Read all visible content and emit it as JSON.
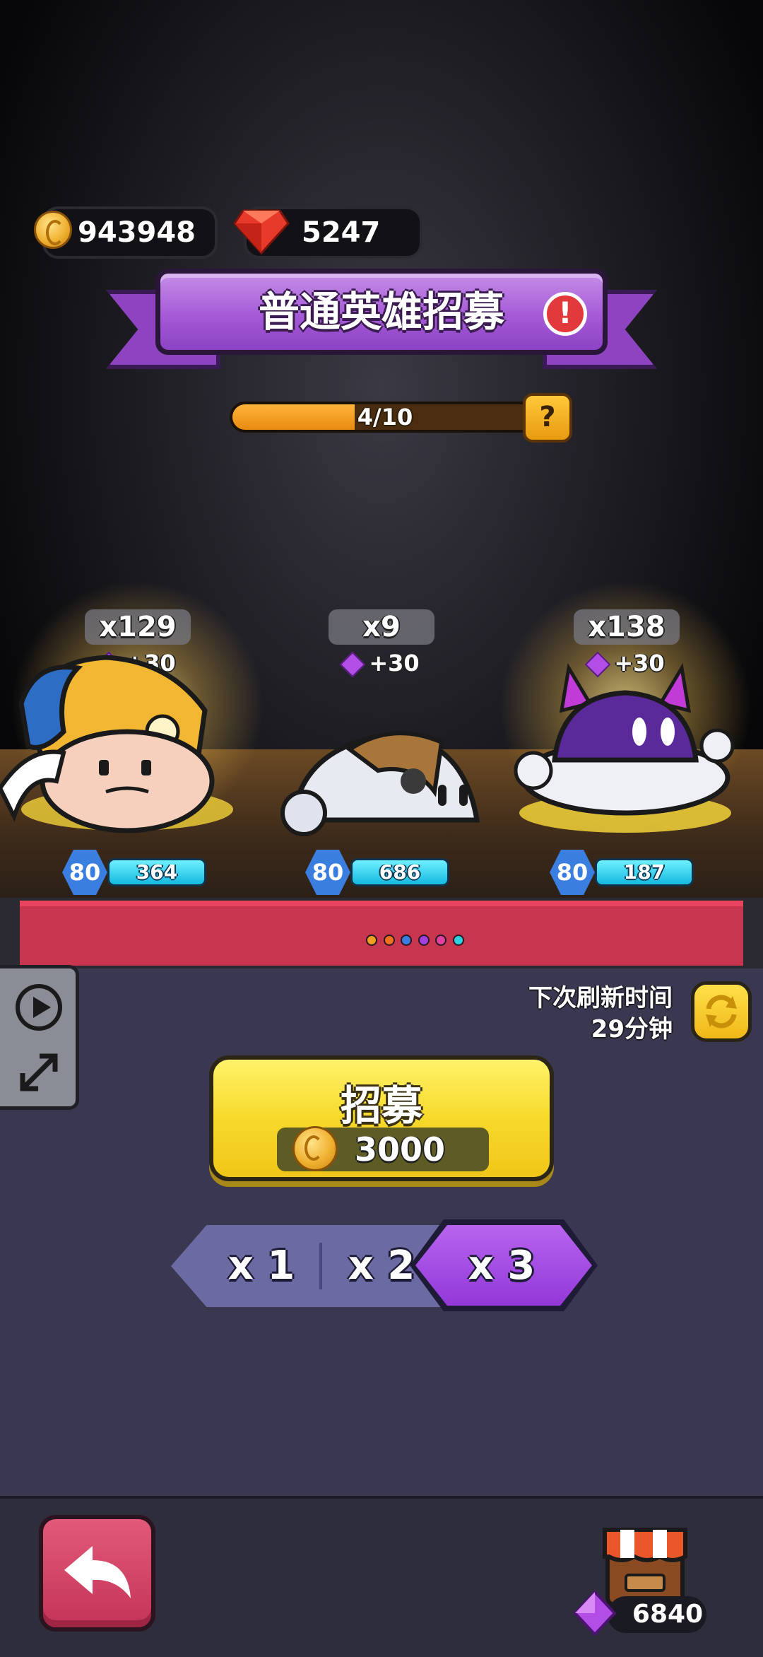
{
  "currency": {
    "coins": "943948",
    "rubies": "5247"
  },
  "banner": {
    "title": "普通英雄招募",
    "alert_glyph": "!"
  },
  "progress": {
    "text": "4/10",
    "current": 4,
    "max": 10,
    "help_glyph": "?"
  },
  "heroes": [
    {
      "count": "x129",
      "bonus": "+30",
      "level": "80",
      "power": "364",
      "glow": true
    },
    {
      "count": "x9",
      "bonus": "+30",
      "level": "80",
      "power": "686",
      "glow": false
    },
    {
      "count": "x138",
      "bonus": "+30",
      "level": "80",
      "power": "187",
      "glow": true
    }
  ],
  "refresh": {
    "line1": "下次刷新时间",
    "line2": "29分钟",
    "icon": "refresh-icon"
  },
  "recruit": {
    "label": "招募",
    "cost": "3000"
  },
  "multipliers": {
    "x1": "x 1",
    "x2": "x 2",
    "x3": "x 3",
    "selected": "x3"
  },
  "shop": {
    "gems": "6840",
    "icon": "shop-icon"
  },
  "side_panel": {
    "play": "play-icon",
    "expand": "expand-icon"
  },
  "colors": {
    "accent_purple": "#a55ad6",
    "gold": "#f7d92a",
    "back_red": "#c43358"
  }
}
